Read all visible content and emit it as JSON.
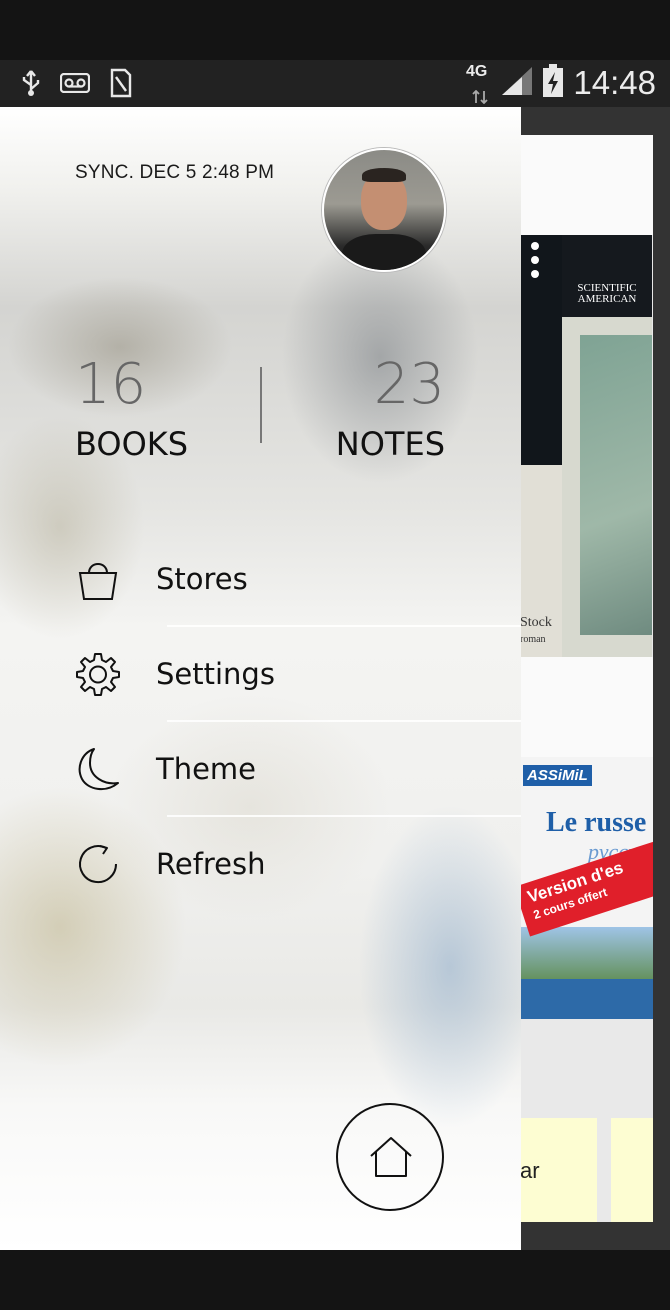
{
  "status_bar": {
    "network": "4G",
    "time": "14:48",
    "icons": [
      "usb-icon",
      "voicemail-icon",
      "sim-card-icon",
      "signal-icon",
      "battery-charging-icon"
    ]
  },
  "drawer": {
    "sync_text": "SYNC. DEC 5 2:48 PM",
    "stats": {
      "books_count": "16",
      "books_label": "BOOKS",
      "notes_count": "23",
      "notes_label": "NOTES"
    },
    "menu": [
      {
        "label": "Stores",
        "icon": "shopping-bag-icon"
      },
      {
        "label": "Settings",
        "icon": "gear-icon"
      },
      {
        "label": "Theme",
        "icon": "moon-icon"
      },
      {
        "label": "Refresh",
        "icon": "refresh-icon"
      }
    ],
    "home_icon": "home-icon"
  },
  "background": {
    "book1_publisher": "SCIENTIFIC AMERICAN",
    "book1_text": "Stock",
    "book1_subtext": "roman",
    "book2_brand": "ASSiMiL",
    "book2_title": "Le russe",
    "book2_subtitle": "русски",
    "book2_band": "Version d'es",
    "book2_band_sub": "2 cours offert",
    "note_text": "ar"
  },
  "colors": {
    "status_bar": "#222222",
    "note_yellow": "#fdfdd2"
  }
}
